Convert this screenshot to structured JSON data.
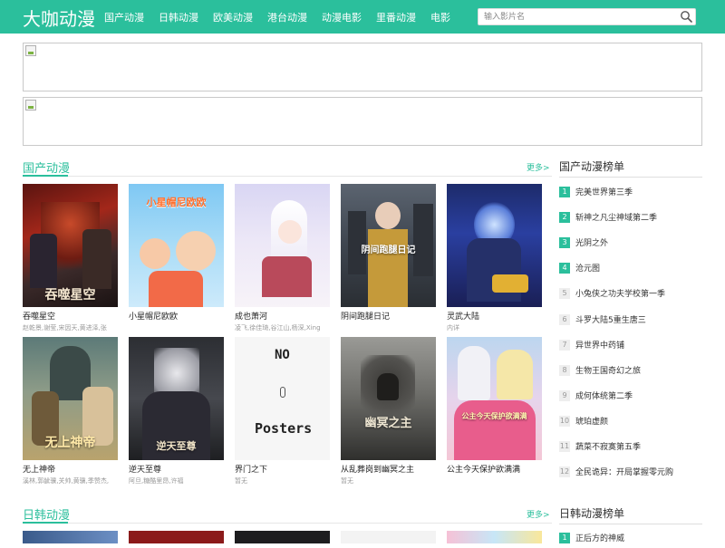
{
  "site": {
    "logo": "大咖动漫"
  },
  "nav": [
    "国产动漫",
    "日韩动漫",
    "欧美动漫",
    "港台动漫",
    "动漫电影",
    "里番动漫",
    "电影"
  ],
  "search": {
    "placeholder": "输入影片名",
    "icon": "search-icon"
  },
  "section1": {
    "title": "国产动漫",
    "more": "更多>",
    "items": [
      {
        "title": "吞噬星空",
        "sub": "赵乾景,谢莹,宋因天,黄进泽,张",
        "poster_text": "吞噬星空"
      },
      {
        "title": "小星帽尼欧欧",
        "sub": "",
        "poster_text": "小星帽尼欧欧"
      },
      {
        "title": "成也萧河",
        "sub": "凌飞,徐佳琦,谷江山,杨深,Xing",
        "poster_text": ""
      },
      {
        "title": "阴间跑腿日记",
        "sub": "",
        "poster_text": "阴间跑腿日记"
      },
      {
        "title": "灵武大陆",
        "sub": "内详",
        "poster_text": ""
      },
      {
        "title": "无上神帝",
        "sub": "溪林,郭龇骥,关帅,黄骥,季赞杰,",
        "poster_text": "无上神帝"
      },
      {
        "title": "逆天至尊",
        "sub": "阿旦,糖酷里昂,许福",
        "poster_text": "逆天至尊"
      },
      {
        "title": "界门之下",
        "sub": "暂无",
        "poster_text": ""
      },
      {
        "title": "从乱葬岗到幽冥之主",
        "sub": "暂无",
        "poster_text": "幽冥之主"
      },
      {
        "title": "公主今天保护欲满满",
        "sub": "",
        "poster_text": "公主今天保护欲满满"
      }
    ]
  },
  "rank1": {
    "title": "国产动漫榜单",
    "items": [
      {
        "num": "1",
        "name": "完美世界第三季"
      },
      {
        "num": "2",
        "name": "斩神之凡尘神域第二季"
      },
      {
        "num": "3",
        "name": "光阴之外"
      },
      {
        "num": "4",
        "name": "沧元图"
      },
      {
        "num": "5",
        "name": "小兔侠之功夫学校第一季"
      },
      {
        "num": "6",
        "name": "斗罗大陆5重生唐三"
      },
      {
        "num": "7",
        "name": "异世界中药铺"
      },
      {
        "num": "8",
        "name": "生物王国奇幻之旅"
      },
      {
        "num": "9",
        "name": "成何体统第二季"
      },
      {
        "num": "10",
        "name": "琥珀虚颜"
      },
      {
        "num": "11",
        "name": "蔬菜不寂寞第五季"
      },
      {
        "num": "12",
        "name": "全民诡异：开局掌握零元购"
      }
    ]
  },
  "section2": {
    "title": "日韩动漫",
    "more": "更多>"
  },
  "rank2": {
    "title": "日韩动漫榜单",
    "items": [
      {
        "num": "1",
        "name": "正后方的神威"
      }
    ]
  },
  "colors": {
    "accent": "#2bbf9c",
    "rank_hot": "#2bbf9c",
    "rank_default": "#eeeeee"
  }
}
